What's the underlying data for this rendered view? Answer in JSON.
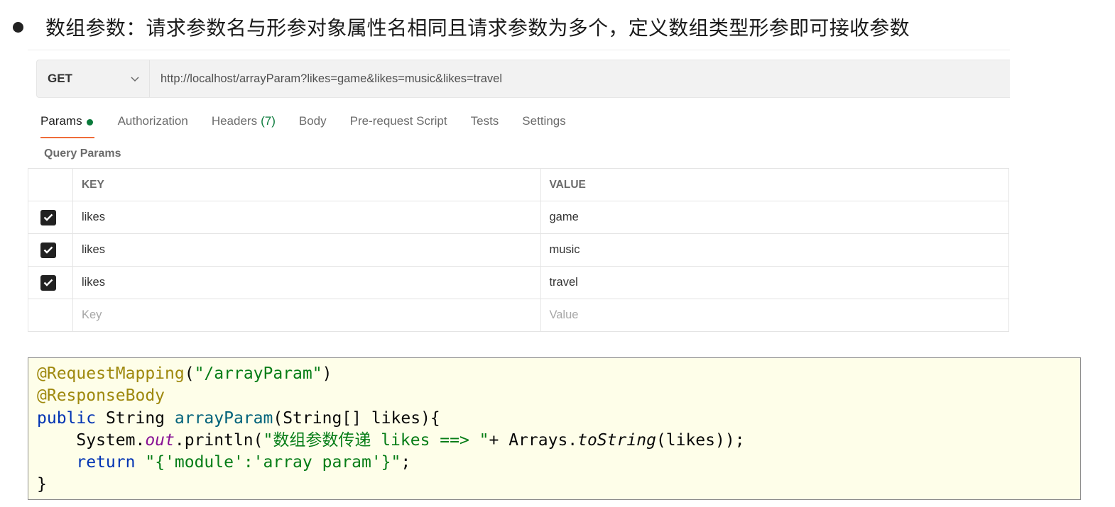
{
  "heading": "数组参数：请求参数名与形参对象属性名相同且请求参数为多个，定义数组类型形参即可接收参数",
  "request": {
    "method": "GET",
    "url": "http://localhost/arrayParam?likes=game&likes=music&likes=travel"
  },
  "tabs": [
    {
      "label": "Params"
    },
    {
      "label": "Authorization"
    },
    {
      "label": "Headers",
      "count": "(7)"
    },
    {
      "label": "Body"
    },
    {
      "label": "Pre-request Script"
    },
    {
      "label": "Tests"
    },
    {
      "label": "Settings"
    }
  ],
  "query_params": {
    "title": "Query Params",
    "columns": {
      "key": "KEY",
      "value": "VALUE"
    },
    "rows": [
      {
        "key": "likes",
        "value": "game",
        "checked": true
      },
      {
        "key": "likes",
        "value": "music",
        "checked": true
      },
      {
        "key": "likes",
        "value": "travel",
        "checked": true
      }
    ],
    "placeholder": {
      "key": "Key",
      "value": "Value"
    }
  },
  "code": {
    "l1_ann": "@RequestMapping",
    "l1_open": "(",
    "l1_str": "\"/arrayParam\"",
    "l1_close": ")",
    "l2_ann": "@ResponseBody",
    "l3_kw": "public",
    "l3_type": " String ",
    "l3_fn": "arrayParam",
    "l3_rest": "(String[] likes){",
    "l4_indent": "    System.",
    "l4_field": "out",
    "l4_call": ".println(",
    "l4_str": "\"数组参数传递 likes ==> \"",
    "l4_plus": "+ Arrays.",
    "l4_static": "toString",
    "l4_end": "(likes));",
    "l5_indent": "    ",
    "l5_kw": "return",
    "l5_space": " ",
    "l5_str": "\"{'module':'array param'}\"",
    "l5_end": ";",
    "l6": "}"
  },
  "colors": {
    "tab_underline": "#ef6c3a",
    "params_dot": "#0a7a3b",
    "code_bg": "#fefee9",
    "annotation": "#9e880d",
    "keyword": "#0033b3",
    "string": "#067d17"
  }
}
